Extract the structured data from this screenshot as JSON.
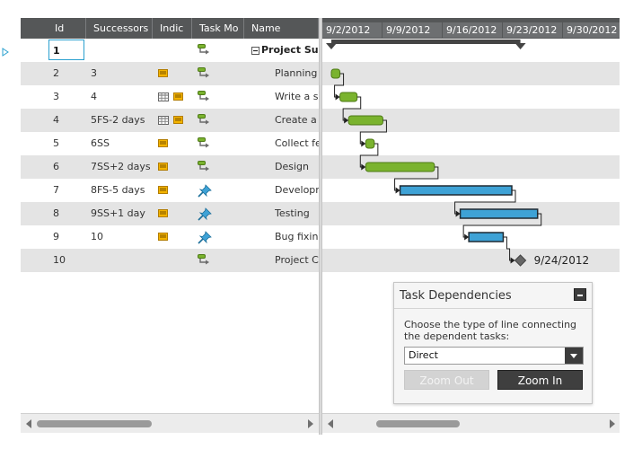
{
  "grid": {
    "columns": [
      {
        "key": "id",
        "label": "Id"
      },
      {
        "key": "successors",
        "label": "Successors"
      },
      {
        "key": "indicators",
        "label": "Indic"
      },
      {
        "key": "task_mode",
        "label": "Task Mo"
      },
      {
        "key": "name",
        "label": "Name"
      }
    ],
    "rows": [
      {
        "id": "1",
        "successors": "",
        "notes": false,
        "calendar": false,
        "mode": "auto",
        "name": "Project Sum",
        "summary": true
      },
      {
        "id": "2",
        "successors": "3",
        "notes": true,
        "calendar": false,
        "mode": "auto",
        "name": "Planning"
      },
      {
        "id": "3",
        "successors": "4",
        "notes": true,
        "calendar": true,
        "mode": "auto",
        "name": "Write a sp"
      },
      {
        "id": "4",
        "successors": "5FS-2 days",
        "notes": true,
        "calendar": true,
        "mode": "auto",
        "name": "Create a d"
      },
      {
        "id": "5",
        "successors": "6SS",
        "notes": true,
        "calendar": false,
        "mode": "auto",
        "name": "Collect fee"
      },
      {
        "id": "6",
        "successors": "7SS+2 days",
        "notes": true,
        "calendar": false,
        "mode": "auto",
        "name": "Design"
      },
      {
        "id": "7",
        "successors": "8FS-5 days",
        "notes": true,
        "calendar": false,
        "mode": "manual",
        "name": "Developm"
      },
      {
        "id": "8",
        "successors": "9SS+1 day",
        "notes": true,
        "calendar": false,
        "mode": "manual",
        "name": "Testing"
      },
      {
        "id": "9",
        "successors": "10",
        "notes": true,
        "calendar": false,
        "mode": "manual",
        "name": "Bug fixing"
      },
      {
        "id": "10",
        "successors": "",
        "notes": false,
        "calendar": false,
        "mode": "auto",
        "name": "Project Co"
      }
    ]
  },
  "timeline": {
    "ticks": [
      "9/2/2012",
      "9/9/2012",
      "9/16/2012",
      "9/23/2012",
      "9/30/2012"
    ],
    "tasks": [
      {
        "row": 0,
        "kind": "summary",
        "start": "2012-09-02",
        "end": "2012-09-24"
      },
      {
        "row": 1,
        "kind": "auto",
        "start": "2012-09-02",
        "end": "2012-09-03"
      },
      {
        "row": 2,
        "kind": "auto",
        "start": "2012-09-03",
        "end": "2012-09-05"
      },
      {
        "row": 3,
        "kind": "auto",
        "start": "2012-09-04",
        "end": "2012-09-08"
      },
      {
        "row": 4,
        "kind": "auto",
        "start": "2012-09-06",
        "end": "2012-09-07"
      },
      {
        "row": 5,
        "kind": "auto",
        "start": "2012-09-06",
        "end": "2012-09-14"
      },
      {
        "row": 6,
        "kind": "manual",
        "start": "2012-09-10",
        "end": "2012-09-23"
      },
      {
        "row": 7,
        "kind": "manual",
        "start": "2012-09-17",
        "end": "2012-09-26"
      },
      {
        "row": 8,
        "kind": "manual",
        "start": "2012-09-18",
        "end": "2012-09-22"
      },
      {
        "row": 9,
        "kind": "milestone",
        "start": "2012-09-24",
        "end": "2012-09-24",
        "label": "9/24/2012"
      }
    ],
    "links": [
      [
        1,
        2
      ],
      [
        2,
        3
      ],
      [
        3,
        4
      ],
      [
        4,
        5
      ],
      [
        5,
        6
      ],
      [
        6,
        7
      ],
      [
        7,
        8
      ],
      [
        8,
        9
      ]
    ]
  },
  "panel": {
    "title": "Task Dependencies",
    "description": "Choose the type of line connecting the dependent tasks:",
    "selected_option": "Direct",
    "zoom_out_label": "Zoom Out",
    "zoom_in_label": "Zoom In"
  },
  "colors": {
    "header": "#555758",
    "alt_row": "#e4e4e4",
    "auto_bar": "#7ab32e",
    "manual_bar": "#3ea2d6",
    "summary_bar": "#444444"
  }
}
